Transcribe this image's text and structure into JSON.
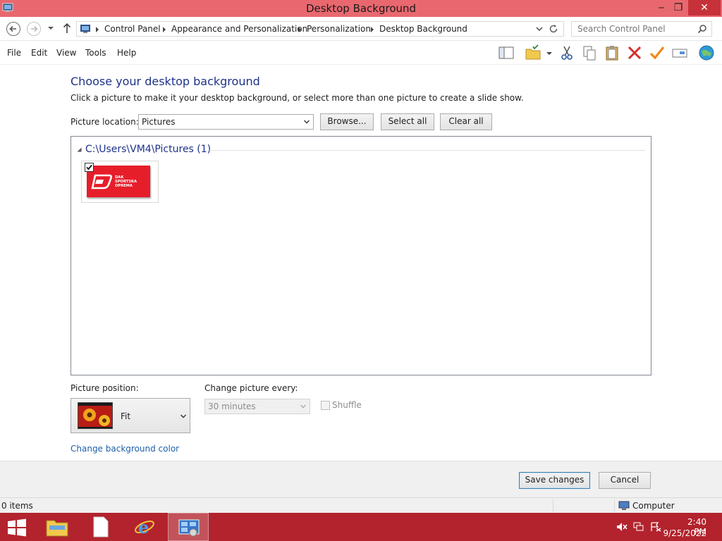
{
  "window": {
    "title": "Desktop Background",
    "min_glyph": "‒",
    "max_glyph": "❐",
    "close_glyph": "✕"
  },
  "address": {
    "breadcrumbs": [
      "Control Panel",
      "Appearance and Personalization",
      "Personalization",
      "Desktop Background"
    ]
  },
  "search": {
    "placeholder": "Search Control Panel"
  },
  "menu": {
    "items": [
      "File",
      "Edit",
      "View",
      "Tools",
      "Help"
    ]
  },
  "toolbar": {
    "icons": [
      "layout-pane-icon",
      "folder-options-icon",
      "cut-icon",
      "copy-icon",
      "paste-icon",
      "delete-icon",
      "check-icon",
      "properties-icon",
      "globe-icon"
    ]
  },
  "page": {
    "heading": "Choose your desktop background",
    "subtitle": "Click a picture to make it your desktop background, or select more than one picture to create a slide show.",
    "picture_location_label": "Picture location:",
    "picture_location_value": "Pictures",
    "browse_label": "Browse...",
    "select_all_label": "Select all",
    "clear_all_label": "Clear all"
  },
  "gallery": {
    "group_header": "C:\\Users\\VM4\\Pictures (1)",
    "pictures": [
      {
        "checked": true,
        "logo_text_lines": [
          "DAK",
          "SPORTSKA",
          "OPREMA"
        ],
        "bg_color": "#e61e2a"
      }
    ]
  },
  "options": {
    "picture_position_label": "Picture position:",
    "picture_position_value": "Fit",
    "change_every_label": "Change picture every:",
    "change_every_value": "30 minutes",
    "shuffle_label": "Shuffle",
    "shuffle_checked": false,
    "change_bg_color_link": "Change background color"
  },
  "footer": {
    "save_label": "Save changes",
    "cancel_label": "Cancel"
  },
  "status": {
    "items_count": "0 items",
    "location": "Computer"
  },
  "taskbar": {
    "time": "2:40 PM",
    "date": "9/25/2022"
  },
  "colors": {
    "titlebar": "#e9686f",
    "close": "#c7323a",
    "taskbar": "#b2232d",
    "heading": "#1e3287",
    "link": "#1c5eab"
  }
}
